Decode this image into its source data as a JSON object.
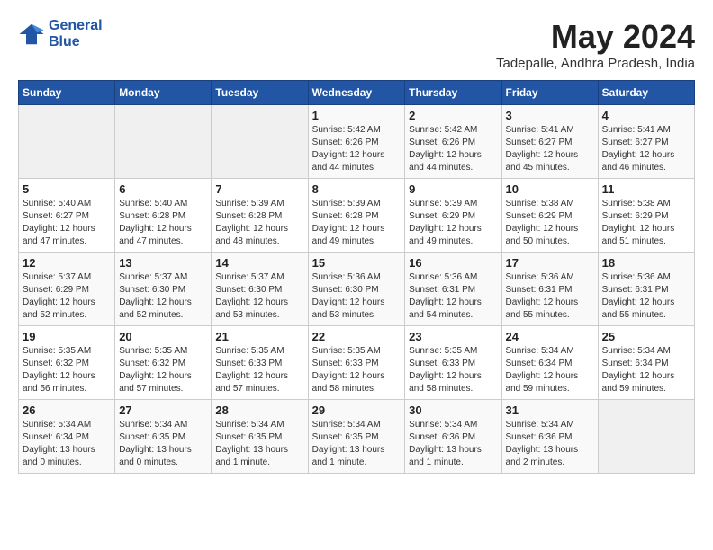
{
  "logo": {
    "line1": "General",
    "line2": "Blue"
  },
  "title": "May 2024",
  "location": "Tadepalle, Andhra Pradesh, India",
  "days_of_week": [
    "Sunday",
    "Monday",
    "Tuesday",
    "Wednesday",
    "Thursday",
    "Friday",
    "Saturday"
  ],
  "weeks": [
    [
      {
        "day": "",
        "sunrise": "",
        "sunset": "",
        "daylight": ""
      },
      {
        "day": "",
        "sunrise": "",
        "sunset": "",
        "daylight": ""
      },
      {
        "day": "",
        "sunrise": "",
        "sunset": "",
        "daylight": ""
      },
      {
        "day": "1",
        "sunrise": "5:42 AM",
        "sunset": "6:26 PM",
        "daylight": "12 hours and 44 minutes."
      },
      {
        "day": "2",
        "sunrise": "5:42 AM",
        "sunset": "6:26 PM",
        "daylight": "12 hours and 44 minutes."
      },
      {
        "day": "3",
        "sunrise": "5:41 AM",
        "sunset": "6:27 PM",
        "daylight": "12 hours and 45 minutes."
      },
      {
        "day": "4",
        "sunrise": "5:41 AM",
        "sunset": "6:27 PM",
        "daylight": "12 hours and 46 minutes."
      }
    ],
    [
      {
        "day": "5",
        "sunrise": "5:40 AM",
        "sunset": "6:27 PM",
        "daylight": "12 hours and 47 minutes."
      },
      {
        "day": "6",
        "sunrise": "5:40 AM",
        "sunset": "6:28 PM",
        "daylight": "12 hours and 47 minutes."
      },
      {
        "day": "7",
        "sunrise": "5:39 AM",
        "sunset": "6:28 PM",
        "daylight": "12 hours and 48 minutes."
      },
      {
        "day": "8",
        "sunrise": "5:39 AM",
        "sunset": "6:28 PM",
        "daylight": "12 hours and 49 minutes."
      },
      {
        "day": "9",
        "sunrise": "5:39 AM",
        "sunset": "6:29 PM",
        "daylight": "12 hours and 49 minutes."
      },
      {
        "day": "10",
        "sunrise": "5:38 AM",
        "sunset": "6:29 PM",
        "daylight": "12 hours and 50 minutes."
      },
      {
        "day": "11",
        "sunrise": "5:38 AM",
        "sunset": "6:29 PM",
        "daylight": "12 hours and 51 minutes."
      }
    ],
    [
      {
        "day": "12",
        "sunrise": "5:37 AM",
        "sunset": "6:29 PM",
        "daylight": "12 hours and 52 minutes."
      },
      {
        "day": "13",
        "sunrise": "5:37 AM",
        "sunset": "6:30 PM",
        "daylight": "12 hours and 52 minutes."
      },
      {
        "day": "14",
        "sunrise": "5:37 AM",
        "sunset": "6:30 PM",
        "daylight": "12 hours and 53 minutes."
      },
      {
        "day": "15",
        "sunrise": "5:36 AM",
        "sunset": "6:30 PM",
        "daylight": "12 hours and 53 minutes."
      },
      {
        "day": "16",
        "sunrise": "5:36 AM",
        "sunset": "6:31 PM",
        "daylight": "12 hours and 54 minutes."
      },
      {
        "day": "17",
        "sunrise": "5:36 AM",
        "sunset": "6:31 PM",
        "daylight": "12 hours and 55 minutes."
      },
      {
        "day": "18",
        "sunrise": "5:36 AM",
        "sunset": "6:31 PM",
        "daylight": "12 hours and 55 minutes."
      }
    ],
    [
      {
        "day": "19",
        "sunrise": "5:35 AM",
        "sunset": "6:32 PM",
        "daylight": "12 hours and 56 minutes."
      },
      {
        "day": "20",
        "sunrise": "5:35 AM",
        "sunset": "6:32 PM",
        "daylight": "12 hours and 57 minutes."
      },
      {
        "day": "21",
        "sunrise": "5:35 AM",
        "sunset": "6:33 PM",
        "daylight": "12 hours and 57 minutes."
      },
      {
        "day": "22",
        "sunrise": "5:35 AM",
        "sunset": "6:33 PM",
        "daylight": "12 hours and 58 minutes."
      },
      {
        "day": "23",
        "sunrise": "5:35 AM",
        "sunset": "6:33 PM",
        "daylight": "12 hours and 58 minutes."
      },
      {
        "day": "24",
        "sunrise": "5:34 AM",
        "sunset": "6:34 PM",
        "daylight": "12 hours and 59 minutes."
      },
      {
        "day": "25",
        "sunrise": "5:34 AM",
        "sunset": "6:34 PM",
        "daylight": "12 hours and 59 minutes."
      }
    ],
    [
      {
        "day": "26",
        "sunrise": "5:34 AM",
        "sunset": "6:34 PM",
        "daylight": "13 hours and 0 minutes."
      },
      {
        "day": "27",
        "sunrise": "5:34 AM",
        "sunset": "6:35 PM",
        "daylight": "13 hours and 0 minutes."
      },
      {
        "day": "28",
        "sunrise": "5:34 AM",
        "sunset": "6:35 PM",
        "daylight": "13 hours and 1 minute."
      },
      {
        "day": "29",
        "sunrise": "5:34 AM",
        "sunset": "6:35 PM",
        "daylight": "13 hours and 1 minute."
      },
      {
        "day": "30",
        "sunrise": "5:34 AM",
        "sunset": "6:36 PM",
        "daylight": "13 hours and 1 minute."
      },
      {
        "day": "31",
        "sunrise": "5:34 AM",
        "sunset": "6:36 PM",
        "daylight": "13 hours and 2 minutes."
      },
      {
        "day": "",
        "sunrise": "",
        "sunset": "",
        "daylight": ""
      }
    ]
  ]
}
